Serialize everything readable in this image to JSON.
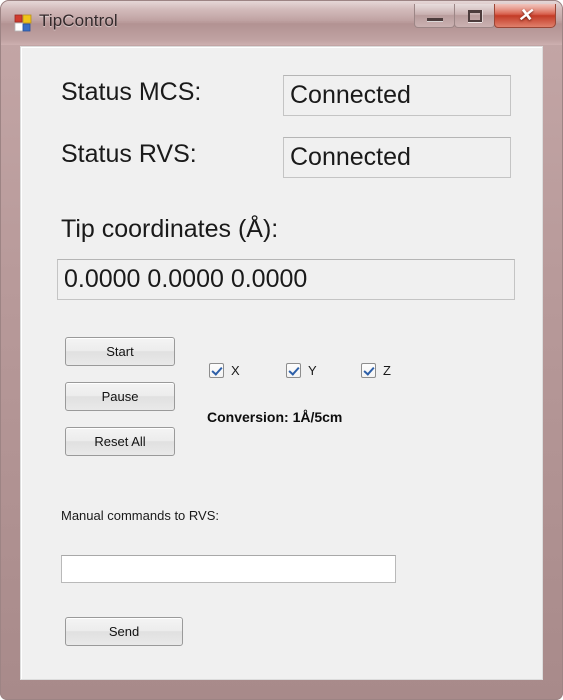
{
  "window": {
    "title": "TipControl",
    "icon": "winforms-app-icon",
    "controls": {
      "minimize": {
        "name": "minimize-button",
        "glyph": "—"
      },
      "maximize": {
        "name": "maximize-button",
        "glyph": "□"
      },
      "close": {
        "name": "close-button",
        "glyph": "✕"
      }
    },
    "frame_color": "#b89a9a",
    "titlebar_color": "#c7a9a9",
    "client_color": "#f0f0f0",
    "close_color": "#c33c28"
  },
  "form": {
    "status_mcs": {
      "label": "Status MCS:",
      "value": "Connected"
    },
    "status_rvs": {
      "label": "Status RVS:",
      "value": "Connected"
    },
    "tip_coordinates": {
      "label": "Tip coordinates (Å):",
      "value": "0.0000  0.0000  0.0000",
      "x": "0.0000",
      "y": "0.0000",
      "z": "0.0000",
      "unit": "Å"
    },
    "buttons": {
      "start": "Start",
      "pause": "Pause",
      "reset_all": "Reset All",
      "send": "Send"
    },
    "axes": [
      {
        "label": "X",
        "checked": true
      },
      {
        "label": "Y",
        "checked": true
      },
      {
        "label": "Z",
        "checked": true
      }
    ],
    "conversion": "Conversion: 1Å/5cm",
    "manual_commands": {
      "label": "Manual commands to RVS:",
      "value": "",
      "placeholder": ""
    }
  }
}
